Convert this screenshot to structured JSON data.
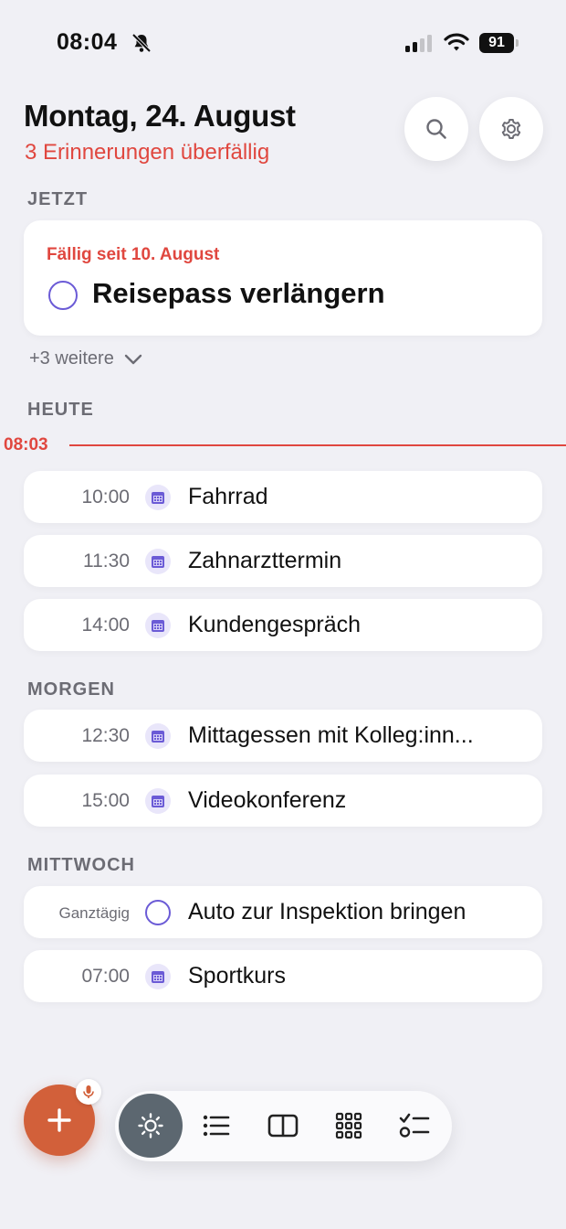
{
  "status_bar": {
    "time": "08:04",
    "battery": "91"
  },
  "header": {
    "title": "Montag, 24. August",
    "subtitle": "3 Erinnerungen überfällig"
  },
  "sections": {
    "now": "JETZT",
    "today": "HEUTE",
    "tomorrow": "MORGEN",
    "wednesday": "MITTWOCH"
  },
  "now_card": {
    "due": "Fällig seit 10. August",
    "title": "Reisepass verlängern",
    "more": "+3 weitere"
  },
  "current_time": "08:03",
  "today": [
    {
      "time": "10:00",
      "title": "Fahrrad",
      "icon": "calendar-icon"
    },
    {
      "time": "11:30",
      "title": "Zahnarzttermin",
      "icon": "calendar-icon"
    },
    {
      "time": "14:00",
      "title": "Kundengespräch",
      "icon": "calendar-icon"
    }
  ],
  "tomorrow": [
    {
      "time": "12:30",
      "title": "Mittagessen mit Kolleg:inn...",
      "icon": "calendar-icon"
    },
    {
      "time": "15:00",
      "title": "Videokonferenz",
      "icon": "calendar-icon"
    }
  ],
  "wednesday": [
    {
      "time": "Ganztägig",
      "title": "Auto zur Inspektion bringen",
      "icon": "todo-circle-icon"
    },
    {
      "time": "07:00",
      "title": "Sportkurs",
      "icon": "calendar-icon"
    }
  ],
  "tabs": [
    "sun-icon",
    "list-icon",
    "split-view-icon",
    "grid-icon",
    "checklist-icon"
  ],
  "colors": {
    "accent": "#6b5bd6",
    "overdue": "#e0473f",
    "fab": "#d2603a",
    "active_tab": "#5c6770"
  }
}
